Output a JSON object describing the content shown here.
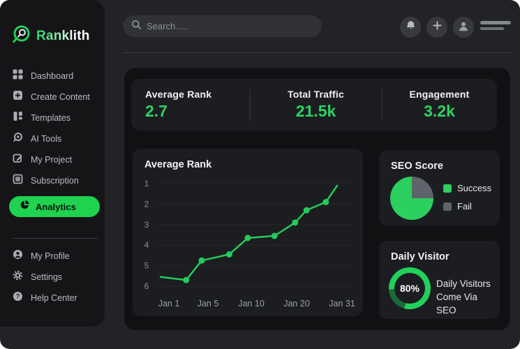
{
  "colors": {
    "accent_green": "#22c55e",
    "pill_green": "#1fd24f",
    "value_green": "#2dd162",
    "fail_gray": "#5f646a",
    "card_bg": "#1c1d20",
    "sidebar_bg": "#151518"
  },
  "sidebar": {
    "logo_text": "Ranklith",
    "logo_icon": "magnifier-rocket-logo-icon",
    "items": [
      {
        "label": "Dashboard",
        "icon": "dashboard-grid-icon",
        "active": false
      },
      {
        "label": "Create Content",
        "icon": "plus-square-icon",
        "active": false
      },
      {
        "label": "Templates",
        "icon": "templates-layout-icon",
        "active": false
      },
      {
        "label": "AI Tools",
        "icon": "ai-tools-icon",
        "active": false
      },
      {
        "label": "My Project",
        "icon": "edit-document-icon",
        "active": false
      },
      {
        "label": "Subscription",
        "icon": "subscription-card-icon",
        "active": false
      },
      {
        "label": "Analytics",
        "icon": "pie-chart-icon",
        "active": true
      }
    ],
    "footer_items": [
      {
        "label": "My Profile",
        "icon": "user-circle-icon"
      },
      {
        "label": "Settings",
        "icon": "gear-icon"
      },
      {
        "label": "Help Center",
        "icon": "question-circle-icon"
      }
    ]
  },
  "topbar": {
    "search_placeholder": "Search.....",
    "search_icon": "search-icon",
    "action_icons": [
      "bell-icon",
      "plus-icon",
      "avatar-icon",
      "menu-icon"
    ]
  },
  "stats": [
    {
      "label": "Average Rank",
      "value": "2.7"
    },
    {
      "label": "Total Traffic",
      "value": "21.5k"
    },
    {
      "label": "Engagement",
      "value": "3.2k"
    }
  ],
  "chart_data": [
    {
      "type": "line",
      "title": "Average Rank",
      "x_tick_labels": [
        "Jan 1",
        "Jan 5",
        "Jan 10",
        "Jan 20",
        "Jan 31"
      ],
      "y_ticks": [
        1,
        2,
        3,
        4,
        5,
        6
      ],
      "y_axis_inverted": true,
      "grid": true,
      "legend_position": "none",
      "line_color": "#24cb5c",
      "points": [
        {
          "x": 0.0,
          "rank": 5.55,
          "dot": false
        },
        {
          "x": 0.145,
          "rank": 5.7,
          "dot": true
        },
        {
          "x": 0.233,
          "rank": 4.75,
          "dot": true
        },
        {
          "x": 0.389,
          "rank": 4.45,
          "dot": true
        },
        {
          "x": 0.494,
          "rank": 3.65,
          "dot": true
        },
        {
          "x": 0.645,
          "rank": 3.55,
          "dot": true
        },
        {
          "x": 0.762,
          "rank": 2.9,
          "dot": true
        },
        {
          "x": 0.827,
          "rank": 2.3,
          "dot": true
        },
        {
          "x": 0.936,
          "rank": 1.9,
          "dot": true
        },
        {
          "x": 1.0,
          "rank": 1.1,
          "dot": false
        }
      ]
    },
    {
      "type": "pie",
      "title": "SEO Score",
      "labels": [
        "Success",
        "Fail"
      ],
      "values": [
        75,
        25
      ],
      "colors": [
        "#2bd05e",
        "#5f646a"
      ],
      "legend_position": "right"
    },
    {
      "type": "donut",
      "title": "Daily Visitor",
      "value": 80,
      "value_label": "80%",
      "description_line1": "Daily Visitors",
      "description_line2": "Come Via SEO",
      "ring_color": "#22d15b",
      "ring_remainder_color": "#1b6b38"
    }
  ]
}
